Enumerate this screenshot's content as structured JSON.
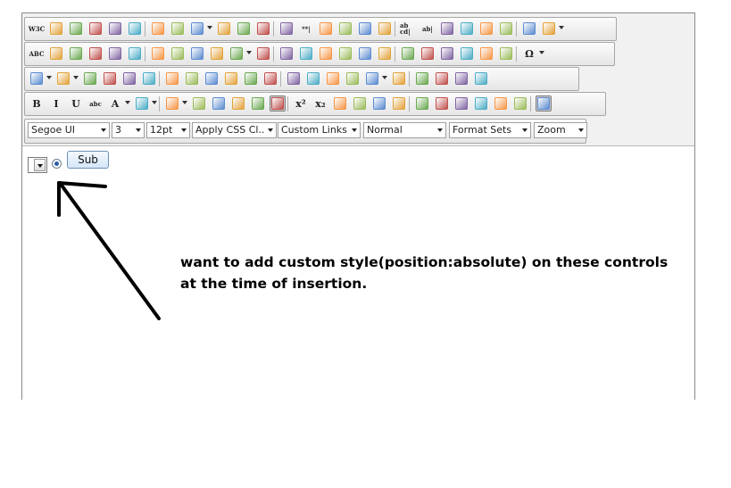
{
  "toolbar": {
    "row1": [
      {
        "icon": "w3c-validate-icon",
        "label": "W3C"
      },
      {
        "icon": "new-page-icon"
      },
      {
        "icon": "print-preview-icon"
      },
      {
        "icon": "format-painter-icon"
      },
      {
        "icon": "cleanup-icon"
      },
      {
        "icon": "insert-image-icon"
      },
      {
        "icon": "insert-link-icon"
      },
      {
        "icon": "insert-table-icon"
      },
      {
        "icon": "insert-form-icon",
        "dropdown": true
      },
      {
        "icon": "fieldset-icon"
      },
      {
        "icon": "form-select-icon"
      },
      {
        "icon": "checkbox-icon"
      },
      {
        "icon": "textbox-icon"
      },
      {
        "icon": "password-icon",
        "label": "**|"
      },
      {
        "icon": "radio-button-icon"
      },
      {
        "icon": "dropdown-list-icon"
      },
      {
        "icon": "listbox-icon"
      },
      {
        "icon": "listbox-select-icon"
      },
      {
        "icon": "text-area-icon",
        "label": "ab cd|"
      },
      {
        "icon": "text-field-icon",
        "label": "ab|"
      },
      {
        "icon": "button-style1-icon"
      },
      {
        "icon": "button-style2-icon"
      },
      {
        "icon": "button-style3-icon"
      },
      {
        "icon": "button-style4-icon"
      },
      {
        "icon": "button-style5-icon"
      },
      {
        "icon": "button-style6-icon",
        "dropdown": true
      }
    ],
    "row2": [
      {
        "icon": "spellcheck-icon",
        "label": "ABC"
      },
      {
        "icon": "image-map-icon"
      },
      {
        "icon": "image-gallery-icon"
      },
      {
        "icon": "image-editor-icon"
      },
      {
        "icon": "flash-icon"
      },
      {
        "icon": "media-icon"
      },
      {
        "icon": "video-icon"
      },
      {
        "icon": "document-icon"
      },
      {
        "icon": "template-icon"
      },
      {
        "icon": "insert-code-icon"
      },
      {
        "icon": "table-icon",
        "dropdown": true
      },
      {
        "icon": "insert-row-above-icon"
      },
      {
        "icon": "insert-row-below-icon"
      },
      {
        "icon": "delete-row-icon"
      },
      {
        "icon": "insert-col-left-icon"
      },
      {
        "icon": "insert-col-right-icon"
      },
      {
        "icon": "delete-col-icon"
      },
      {
        "icon": "merge-cells-icon"
      },
      {
        "icon": "split-cells-icon"
      },
      {
        "icon": "cell-props-icon"
      },
      {
        "icon": "split-row-icon"
      },
      {
        "icon": "delete-table-icon"
      },
      {
        "icon": "table-props-icon"
      },
      {
        "icon": "row-props-icon"
      },
      {
        "icon": "special-char-icon",
        "label": "Ω",
        "dropdown": true
      }
    ],
    "row3": [
      {
        "icon": "undo-icon",
        "dropdown": true
      },
      {
        "icon": "redo-icon",
        "dropdown": true
      },
      {
        "icon": "cut-icon"
      },
      {
        "icon": "copy-icon"
      },
      {
        "icon": "paste-icon"
      },
      {
        "icon": "paste-text-icon"
      },
      {
        "icon": "paste-word-icon"
      },
      {
        "icon": "paste-html-icon"
      },
      {
        "icon": "paste-plain-icon"
      },
      {
        "icon": "paste-clean-icon"
      },
      {
        "icon": "print-icon"
      },
      {
        "icon": "find-icon"
      },
      {
        "icon": "select-all-icon"
      },
      {
        "icon": "page-props-icon"
      },
      {
        "icon": "paragraph-icon"
      },
      {
        "icon": "horizontal-rule-icon"
      },
      {
        "icon": "insert-snippet-icon",
        "dropdown": true
      },
      {
        "icon": "date-icon"
      },
      {
        "icon": "time-icon"
      },
      {
        "icon": "about-icon"
      },
      {
        "icon": "help-icon"
      },
      {
        "icon": "preview-icon"
      }
    ],
    "row4": [
      {
        "icon": "bold-icon",
        "label": "B"
      },
      {
        "icon": "italic-icon",
        "label": "I"
      },
      {
        "icon": "underline-icon",
        "label": "U"
      },
      {
        "icon": "strikethrough-icon",
        "label": "abc"
      },
      {
        "icon": "font-color-icon",
        "label": "A",
        "dropdown": true
      },
      {
        "icon": "highlight-color-icon",
        "dropdown": true
      },
      {
        "icon": "style-brush-icon",
        "dropdown": true
      },
      {
        "icon": "align-left-icon"
      },
      {
        "icon": "align-center-icon"
      },
      {
        "icon": "align-right-icon"
      },
      {
        "icon": "align-justify-icon"
      },
      {
        "icon": "align-none-icon",
        "active": true
      },
      {
        "icon": "superscript-icon",
        "label": "x²"
      },
      {
        "icon": "subscript-icon",
        "label": "x₂"
      },
      {
        "icon": "uppercase-icon"
      },
      {
        "icon": "lowercase-icon"
      },
      {
        "icon": "indent-icon"
      },
      {
        "icon": "outdent-icon"
      },
      {
        "icon": "ordered-list-icon"
      },
      {
        "icon": "unordered-list-icon"
      },
      {
        "icon": "image-placeholder-icon"
      },
      {
        "icon": "link-icon"
      },
      {
        "icon": "unlink-icon"
      },
      {
        "icon": "anchor-icon"
      },
      {
        "icon": "absolute-position-icon",
        "active": true
      }
    ],
    "selects": [
      {
        "name": "font-name-select",
        "value": "Segoe UI"
      },
      {
        "name": "font-size-select",
        "value": "3"
      },
      {
        "name": "font-pt-select",
        "value": "12pt"
      },
      {
        "name": "css-class-select",
        "value": "Apply CSS Cl..."
      },
      {
        "name": "custom-links-select",
        "value": "Custom Links"
      },
      {
        "name": "paragraph-select",
        "value": "Normal"
      },
      {
        "name": "format-sets-select",
        "value": "Format Sets"
      },
      {
        "name": "zoom-select",
        "value": "Zoom"
      }
    ]
  },
  "content": {
    "submit_label": "Sub",
    "note": "want to add custom style(position:absolute) on these controls at the time of insertion."
  }
}
